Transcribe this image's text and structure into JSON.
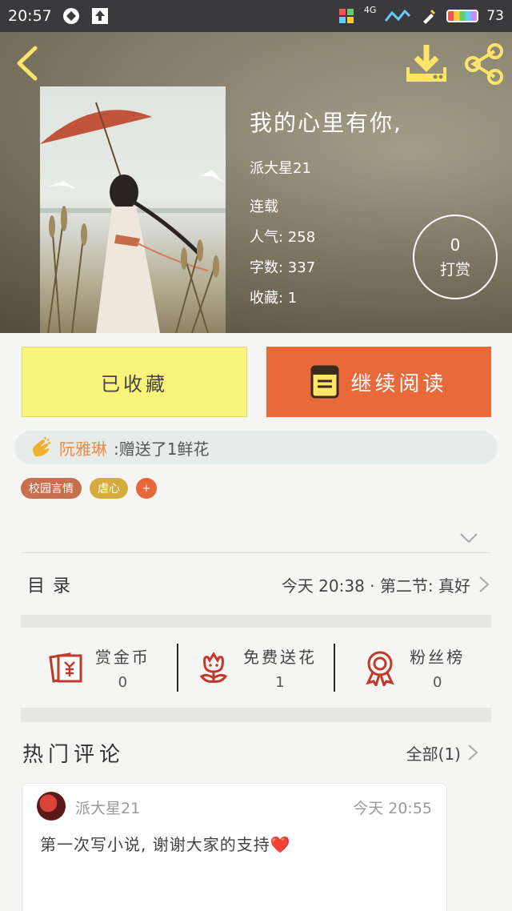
{
  "status_bar": {
    "time": "20:57",
    "network": "4G",
    "battery": "73"
  },
  "header": {
    "back_icon": "chevron-left-icon",
    "download_icon": "download-icon",
    "share_icon": "share-icon"
  },
  "book": {
    "title": "我的心里有你,",
    "author": "派大星21",
    "status": "连载",
    "popularity": "人气: 258",
    "word_count": "字数: 337",
    "favorites": "收藏: 1"
  },
  "reward": {
    "count": "0",
    "label": "打赏"
  },
  "actions": {
    "collected_label": "已收藏",
    "read_label": "继续阅读"
  },
  "gift_notice": {
    "user": "阮雅琳",
    "text": ":赠送了1鲜花"
  },
  "tags": [
    "校园言情",
    "虐心"
  ],
  "tag_add": "+",
  "toc": {
    "label": "目录",
    "latest": "今天 20:38 · 第二节: 真好"
  },
  "stats": [
    {
      "icon": "red-envelope-icon",
      "label": "赏金币",
      "value": "0"
    },
    {
      "icon": "flower-icon",
      "label": "免费送花",
      "value": "1"
    },
    {
      "icon": "medal-icon",
      "label": "粉丝榜",
      "value": "0"
    }
  ],
  "comments": {
    "title": "热门评论",
    "all_label": "全部(1)",
    "items": [
      {
        "user": "派大星21",
        "time": "今天 20:55",
        "text": "第一次写小说, 谢谢大家的支持❤️"
      }
    ]
  },
  "colors": {
    "accent_orange": "#e8693a",
    "collected_yellow": "#fbf47a",
    "icon_red": "#c0392b"
  }
}
